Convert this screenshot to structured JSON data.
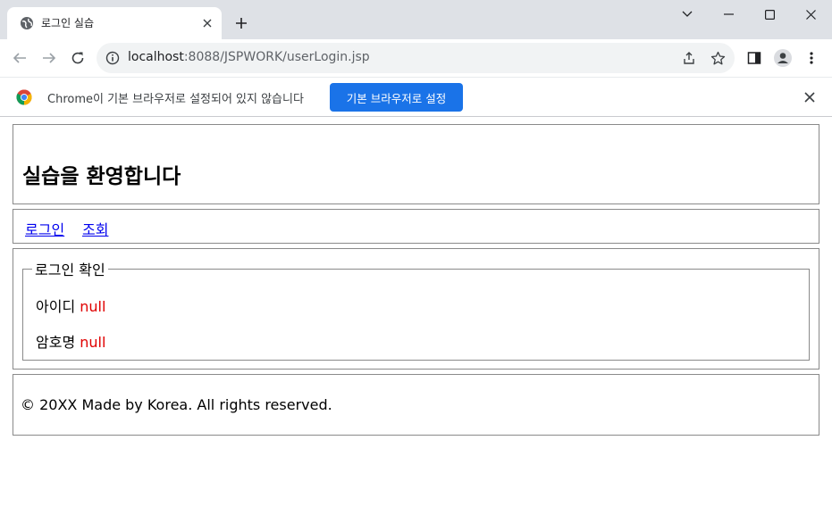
{
  "browser": {
    "tab_title": "로그인 실습",
    "url_host": "localhost",
    "url_path": ":8088/JSPWORK/userLogin.jsp",
    "icons": {
      "favicon": "globe-icon",
      "tab_close": "close-icon",
      "new_tab": "plus-icon",
      "tab_search": "chevron-down-icon",
      "minimize": "minimize-icon",
      "maximize": "maximize-icon",
      "close_window": "close-icon",
      "back": "back-arrow-icon",
      "forward": "forward-arrow-icon",
      "reload": "reload-icon",
      "site_info": "info-icon",
      "share": "share-icon",
      "bookmark": "star-icon",
      "side_panel": "side-panel-icon",
      "profile": "profile-icon",
      "menu": "kebab-menu-icon"
    },
    "infobar": {
      "message": "Chrome이 기본 브라우저로 설정되어 있지 않습니다",
      "button_label": "기본 브라우저로 설정",
      "accent": "#1a73e8"
    }
  },
  "page": {
    "header_title": "실습을 환영합니다",
    "nav_links": [
      "로그인",
      "조회"
    ],
    "login_check": {
      "legend": "로그인 확인",
      "fields": [
        {
          "label": "아이디",
          "value": "null"
        },
        {
          "label": "암호명",
          "value": "null"
        }
      ],
      "value_color": "#e00000"
    },
    "footer_text": "© 20XX Made by Korea. All rights reserved."
  }
}
